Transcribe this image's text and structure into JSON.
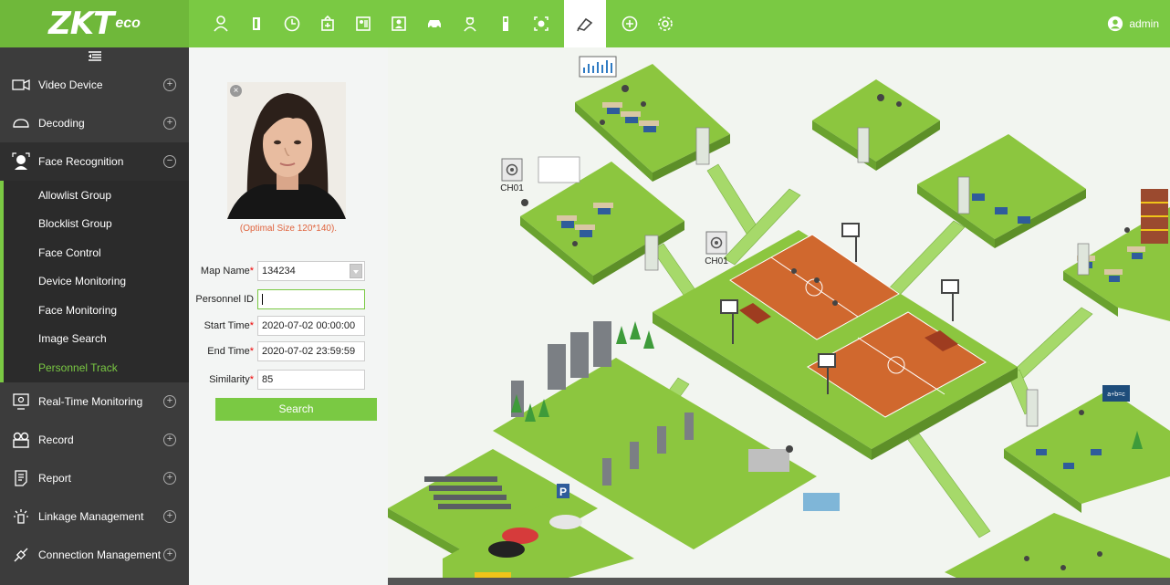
{
  "brand": {
    "logo_main": "ZKT",
    "logo_sub": "eco"
  },
  "top_nav": {
    "icons": [
      "person-icon",
      "door-icon",
      "clock-icon",
      "elevator-icon",
      "visitor-icon",
      "entrance-icon",
      "car-icon",
      "guard-icon",
      "device-icon",
      "face-scan-icon",
      "video-icon",
      "plus-circle-icon",
      "gear-icon"
    ],
    "active_index": 10
  },
  "user": {
    "name": "admin"
  },
  "sidebar": {
    "items": [
      {
        "label": "Video Device",
        "icon": "camera-icon"
      },
      {
        "label": "Decoding",
        "icon": "decoder-icon"
      },
      {
        "label": "Face Recognition",
        "icon": "face-icon",
        "expanded": true
      },
      {
        "label": "Real-Time Monitoring",
        "icon": "monitor-icon"
      },
      {
        "label": "Record",
        "icon": "record-icon"
      },
      {
        "label": "Report",
        "icon": "report-icon"
      },
      {
        "label": "Linkage Management",
        "icon": "linkage-icon"
      },
      {
        "label": "Connection Management",
        "icon": "connection-icon"
      }
    ],
    "submenu": [
      "Allowlist Group",
      "Blocklist Group",
      "Face Control",
      "Device Monitoring",
      "Face Monitoring",
      "Image Search",
      "Personnel Track"
    ],
    "active_sub": "Personnel Track"
  },
  "form": {
    "photo_hint": "(Optimal Size 120*140).",
    "map_name_label": "Map Name",
    "map_name_value": "134234",
    "personnel_id_label": "Personnel ID",
    "personnel_id_value": "",
    "start_time_label": "Start Time",
    "start_time_value": "2020-07-02 00:00:00",
    "end_time_label": "End Time",
    "end_time_value": "2020-07-02 23:59:59",
    "similarity_label": "Similarity",
    "similarity_value": "85",
    "required_mark": "*",
    "search_button": "Search"
  },
  "map": {
    "camera_labels": [
      "CH01",
      "CH01"
    ],
    "parking_label": "P",
    "board_text": "a+b=c",
    "colors": {
      "floor": "#8cc63f",
      "floor_side": "#6aa22f",
      "court": "#d0682e",
      "stairs": "#a6d96a"
    }
  }
}
